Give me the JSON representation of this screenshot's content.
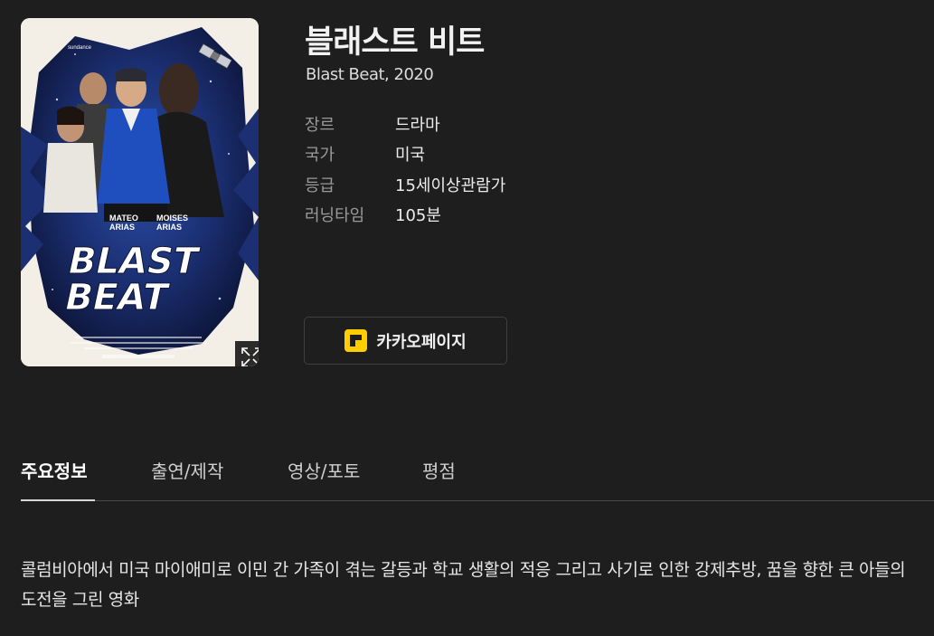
{
  "poster": {
    "alt": "Blast Beat poster",
    "poster_text_top": "sundance",
    "poster_cast_1": "MATEO ARIAS",
    "poster_cast_2": "MOISES ARIAS",
    "poster_logo_line1": "BLAST",
    "poster_logo_line2": "BEAT",
    "expand_icon": "expand-icon"
  },
  "movie": {
    "title": "블래스트 비트",
    "subtitle": "Blast Beat, 2020",
    "info": [
      {
        "label": "장르",
        "value": "드라마"
      },
      {
        "label": "국가",
        "value": "미국"
      },
      {
        "label": "등급",
        "value": "15세이상관람가"
      },
      {
        "label": "러닝타임",
        "value": "105분"
      }
    ]
  },
  "provider": {
    "label": "카카오페이지",
    "icon": "kakaopage-icon",
    "icon_color": "#ffcd00"
  },
  "tabs": [
    {
      "label": "주요정보",
      "active": true
    },
    {
      "label": "출연/제작",
      "active": false
    },
    {
      "label": "영상/포토",
      "active": false
    },
    {
      "label": "평점",
      "active": false
    }
  ],
  "synopsis": "콜럼비아에서 미국 마이애미로 이민 간 가족이 겪는 갈등과 학교 생활의 적응 그리고 사기로 인한 강제추방, 꿈을 향한 큰 아들의 도전을 그린 영화"
}
